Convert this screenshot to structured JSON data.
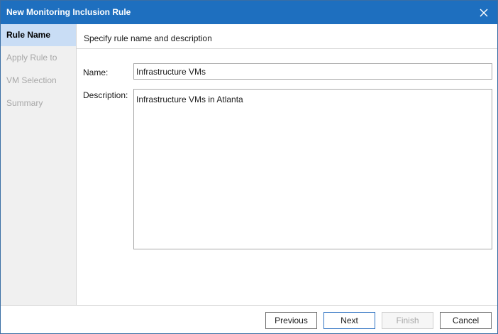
{
  "window": {
    "title": "New Monitoring Inclusion Rule"
  },
  "sidebar": {
    "steps": [
      {
        "label": "Rule Name",
        "active": true
      },
      {
        "label": "Apply Rule to",
        "active": false
      },
      {
        "label": "VM Selection",
        "active": false
      },
      {
        "label": "Summary",
        "active": false
      }
    ]
  },
  "main": {
    "subtitle": "Specify rule name and description",
    "name_label": "Name:",
    "name_value": "Infrastructure VMs",
    "description_label": "Description:",
    "description_value": "Infrastructure VMs in Atlanta"
  },
  "footer": {
    "previous_label": "Previous",
    "next_label": "Next",
    "finish_label": "Finish",
    "cancel_label": "Cancel"
  },
  "colors": {
    "titlebar": "#1e6fbf",
    "active_step": "#c9ddf5",
    "sidebar": "#f0f0f0"
  }
}
